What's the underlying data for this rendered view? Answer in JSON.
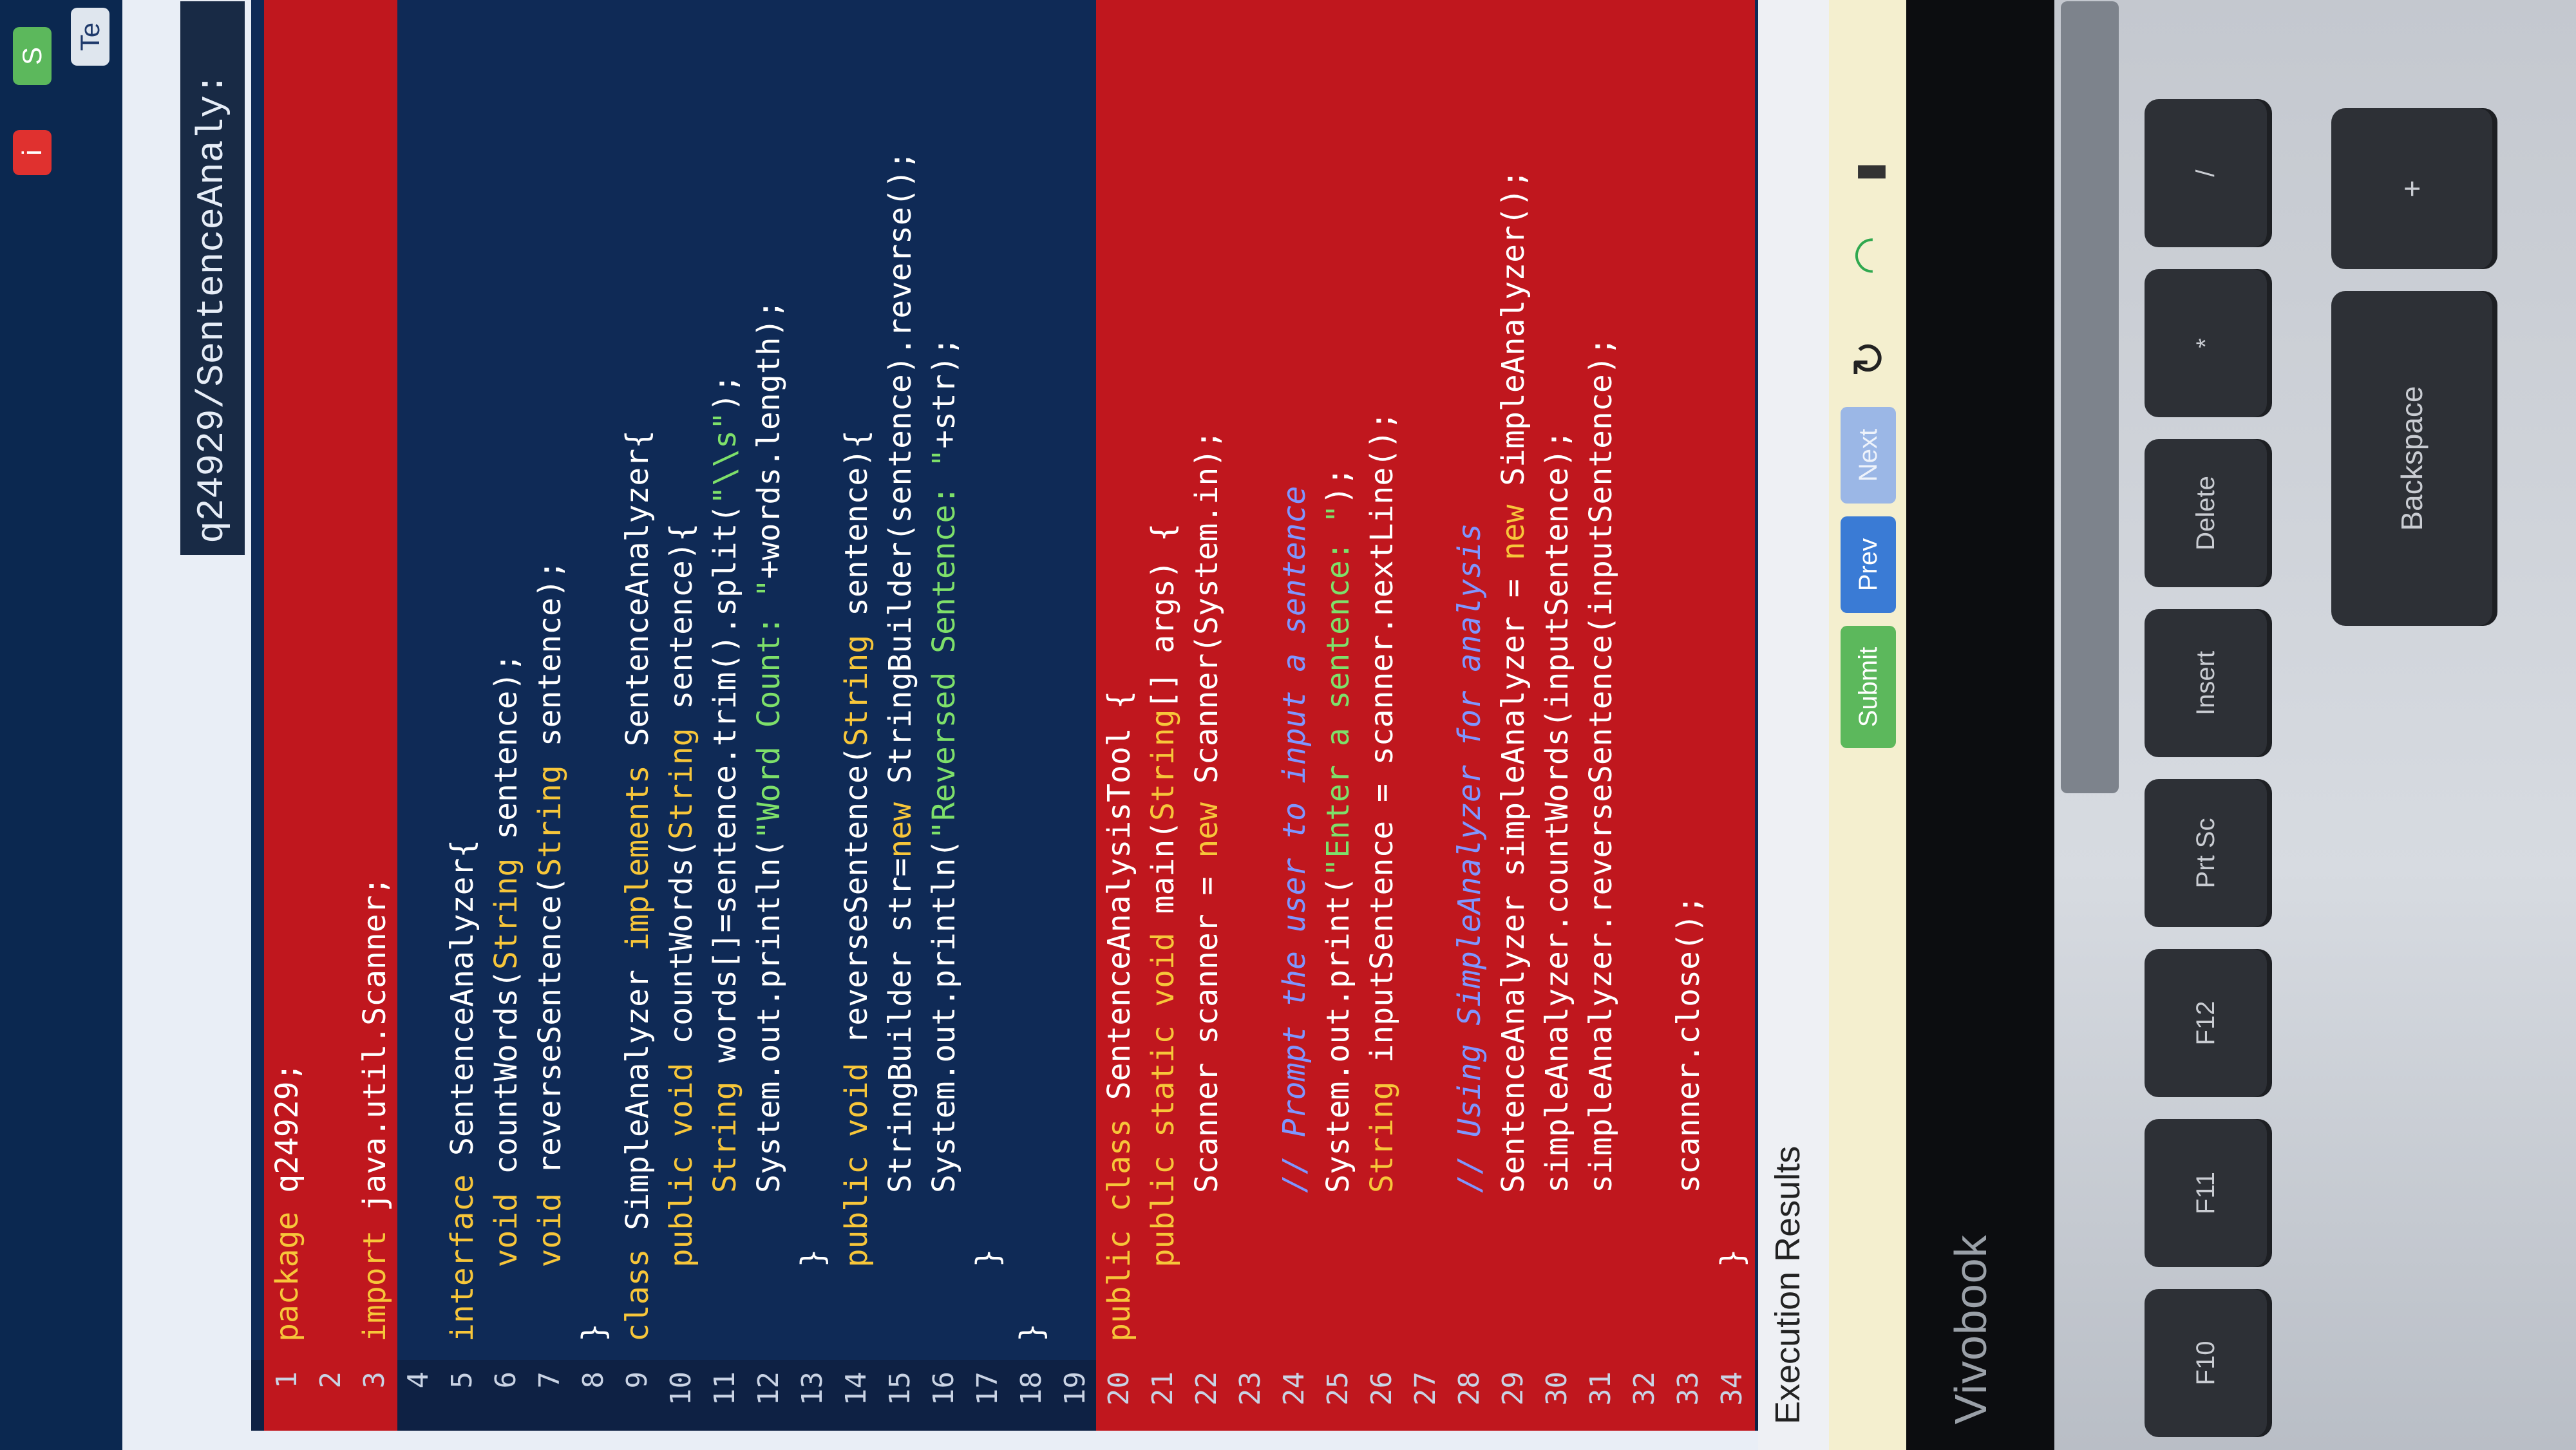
{
  "window": {
    "tab_title": "q24929/SentenceAnaly:",
    "top_buttons": [
      "S",
      "i",
      "Te"
    ]
  },
  "editor": {
    "lines": [
      {
        "n": "1",
        "text": "package q24929;"
      },
      {
        "n": "2",
        "text": ""
      },
      {
        "n": "3",
        "text": "import java.util.Scanner;"
      },
      {
        "n": "4",
        "text": ""
      },
      {
        "n": "5",
        "text": "interface SentenceAnalyzer{"
      },
      {
        "n": "6",
        "text": "    void countWords(String sentence);"
      },
      {
        "n": "7",
        "text": "    void reverseSentence(String sentence);"
      },
      {
        "n": "8",
        "text": "}"
      },
      {
        "n": "9",
        "text": "class SimpleAnalyzer implements SentenceAnalyzer{"
      },
      {
        "n": "10",
        "text": "    public void countWords(String sentence){"
      },
      {
        "n": "11",
        "text": "        String words[]=sentence.trim().split(\"\\\\s\");"
      },
      {
        "n": "12",
        "text": "        System.out.println(\"Word Count: \"+words.length);"
      },
      {
        "n": "13",
        "text": "    }"
      },
      {
        "n": "14",
        "text": "    public void reverseSentence(String sentence){"
      },
      {
        "n": "15",
        "text": "        StringBuilder str=new StringBuilder(sentence).reverse();"
      },
      {
        "n": "16",
        "text": "        System.out.println(\"Reversed Sentence: \"+str);"
      },
      {
        "n": "17",
        "text": "    }"
      },
      {
        "n": "18",
        "text": "}"
      },
      {
        "n": "19",
        "text": ""
      },
      {
        "n": "20",
        "text": "public class SentenceAnalysisTool {"
      },
      {
        "n": "21",
        "text": "    public static void main(String[] args) {"
      },
      {
        "n": "22",
        "text": "        Scanner scanner = new Scanner(System.in);"
      },
      {
        "n": "23",
        "text": ""
      },
      {
        "n": "24",
        "text": "        // Prompt the user to input a sentence"
      },
      {
        "n": "25",
        "text": "        System.out.print(\"Enter a sentence: \");"
      },
      {
        "n": "26",
        "text": "        String inputSentence = scanner.nextLine();"
      },
      {
        "n": "27",
        "text": ""
      },
      {
        "n": "28",
        "text": "        // Using SimpleAnalyzer for analysis"
      },
      {
        "n": "29",
        "text": "        SentenceAnalyzer simpleAnalyzer = new SimpleAnalyzer();"
      },
      {
        "n": "30",
        "text": "        simpleAnalyzer.countWords(inputSentence);"
      },
      {
        "n": "31",
        "text": "        simpleAnalyzer.reverseSentence(inputSentence);"
      },
      {
        "n": "32",
        "text": ""
      },
      {
        "n": "33",
        "text": "        scanner.close();"
      },
      {
        "n": "34",
        "text": "    }"
      }
    ]
  },
  "results": {
    "title": "Execution Results"
  },
  "toolbar": {
    "submit_label": "Submit",
    "prev_label": "Prev",
    "next_label": "Next"
  },
  "laptop": {
    "brand": "Vivobook",
    "keys_row1": [
      "F10",
      "F11",
      "F12",
      "Prt Sc",
      "Insert",
      "Delete",
      "*",
      "/"
    ],
    "keys_row2": [
      "Backspace",
      "+",
      "-"
    ]
  },
  "colors": {
    "editor_bg": "#0f2a56",
    "highlight": "#c0171e",
    "keyword": "#f7c63a",
    "string": "#7ee06a",
    "comment": "#7f96ff"
  }
}
